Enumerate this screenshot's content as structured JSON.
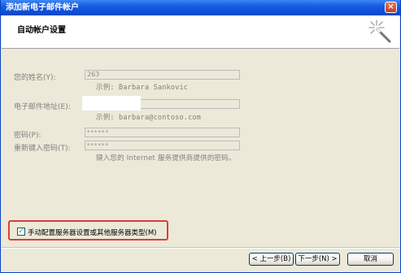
{
  "window": {
    "title": "添加新电子邮件帐户",
    "close_glyph": "×"
  },
  "header": {
    "title": "自动帐户设置"
  },
  "form": {
    "name_label": "您的姓名(Y):",
    "name_value": "263",
    "name_hint": "示例: Barbara Sankovic",
    "email_label": "电子邮件地址(E):",
    "email_value": "",
    "email_hint": "示例: barbara@contoso.com",
    "password_label": "密码(P):",
    "password_value": "******",
    "retype_label": "重新键入密码(T):",
    "retype_value": "******",
    "password_hint": "键入您的 Internet 服务提供商提供的密码。"
  },
  "manual_config": {
    "checked": true,
    "check_glyph": "✓",
    "label": "手动配置服务器设置或其他服务器类型(M)"
  },
  "buttons": {
    "back": "< 上一步(B)",
    "next": "下一步(N) >",
    "cancel": "取消"
  },
  "colors": {
    "titlebar": "#0a50d8",
    "highlight_border": "#e23b3b"
  }
}
